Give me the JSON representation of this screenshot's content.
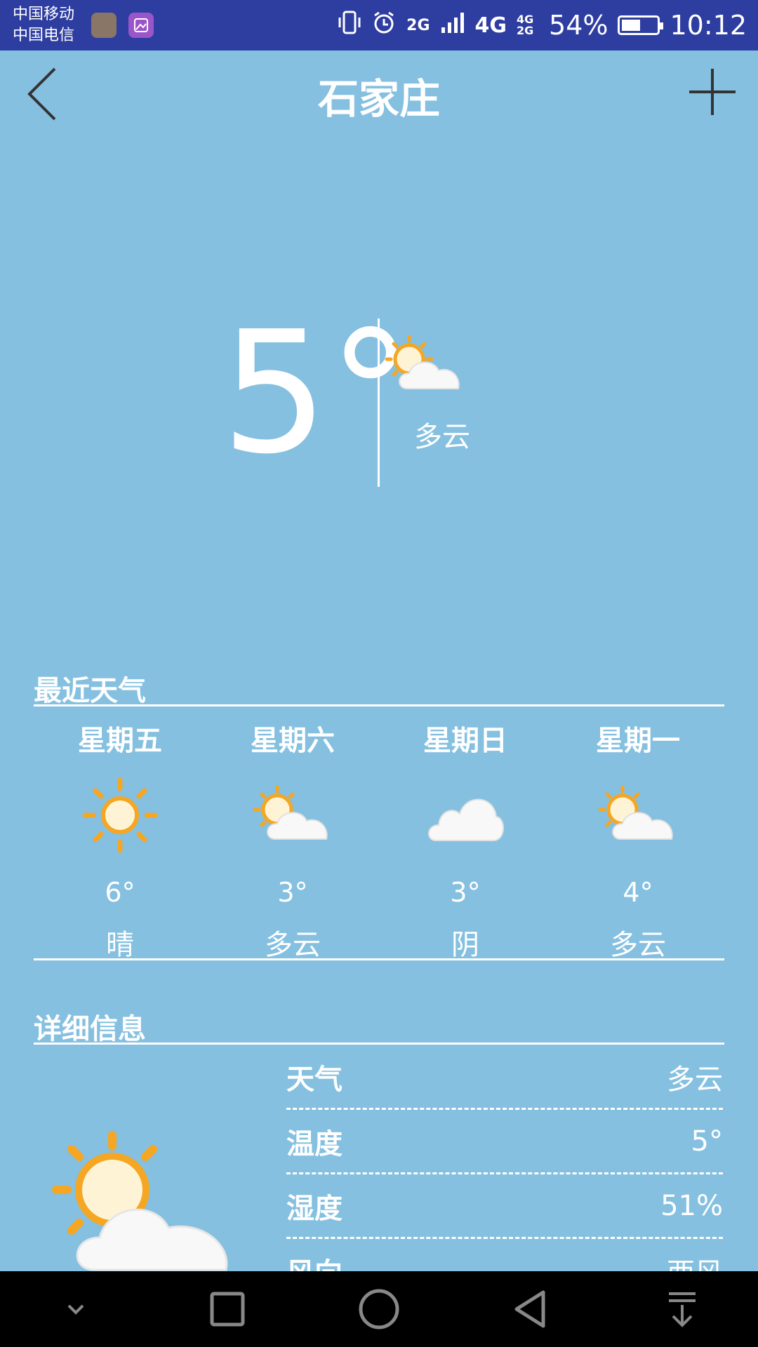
{
  "status_bar": {
    "carrier_1": "中国移动",
    "carrier_2": "中国电信",
    "network_a": "2G",
    "network_b": "4G",
    "network_c": "4G 2G",
    "battery": "54%",
    "battery_level": 0.54,
    "time": "10:12"
  },
  "header": {
    "title": "石家庄"
  },
  "current": {
    "temperature": "5°",
    "condition": "多云"
  },
  "recent": {
    "title": "最近天气",
    "days": [
      {
        "name": "星期五",
        "temp": "6°",
        "condition": "晴",
        "icon": "sun-icon"
      },
      {
        "name": "星期六",
        "temp": "3°",
        "condition": "多云",
        "icon": "partly-cloudy-icon"
      },
      {
        "name": "星期日",
        "temp": "3°",
        "condition": "阴",
        "icon": "cloud-icon"
      },
      {
        "name": "星期一",
        "temp": "4°",
        "condition": "多云",
        "icon": "partly-cloudy-icon"
      }
    ]
  },
  "details": {
    "title": "详细信息",
    "rows": [
      {
        "label": "天气",
        "value": "多云"
      },
      {
        "label": "温度",
        "value": "5°"
      },
      {
        "label": "湿度",
        "value": "51%"
      },
      {
        "label": "风向",
        "value": "西风"
      }
    ]
  },
  "colors": {
    "background": "#85c0e0",
    "status_bar": "#2e3da0",
    "sun": "#f5a623"
  }
}
